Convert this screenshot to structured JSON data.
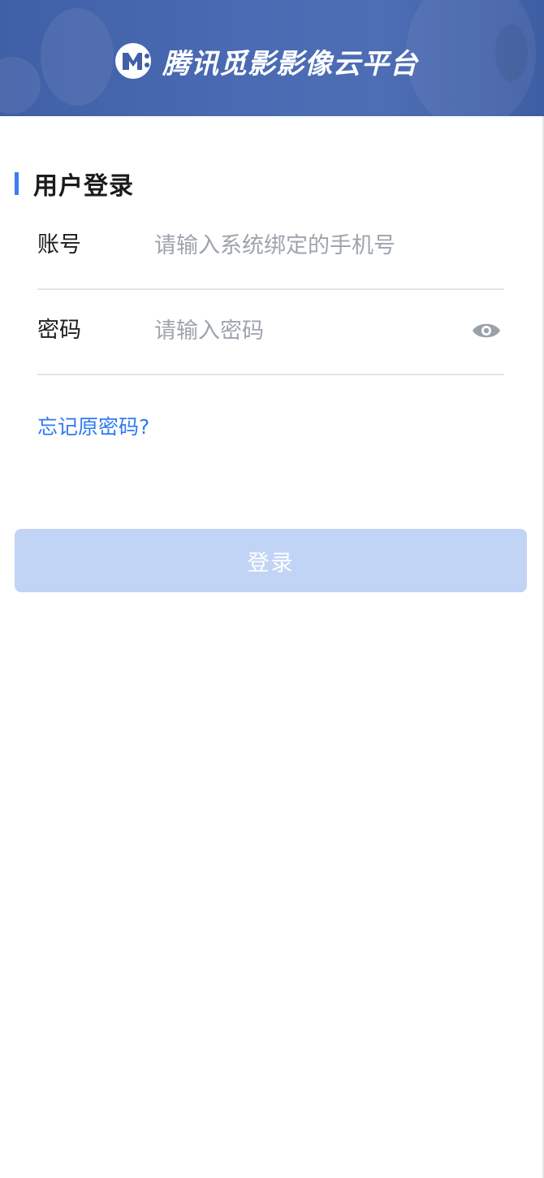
{
  "header": {
    "brand_name": "腾讯觅影影像云平台",
    "logo_icon": "m-logo-icon",
    "background_color": "#4565ad"
  },
  "login": {
    "section_title": "用户登录",
    "accent_color": "#3d7cf2",
    "account": {
      "label": "账号",
      "value": "",
      "placeholder": "请输入系统绑定的手机号"
    },
    "password": {
      "label": "密码",
      "value": "",
      "placeholder": "请输入密码",
      "toggle_icon": "eye-icon"
    },
    "forgot_link": "忘记原密码?",
    "link_color": "#2f7af0",
    "submit_label": "登录",
    "submit_color": "#c2d4f6"
  }
}
